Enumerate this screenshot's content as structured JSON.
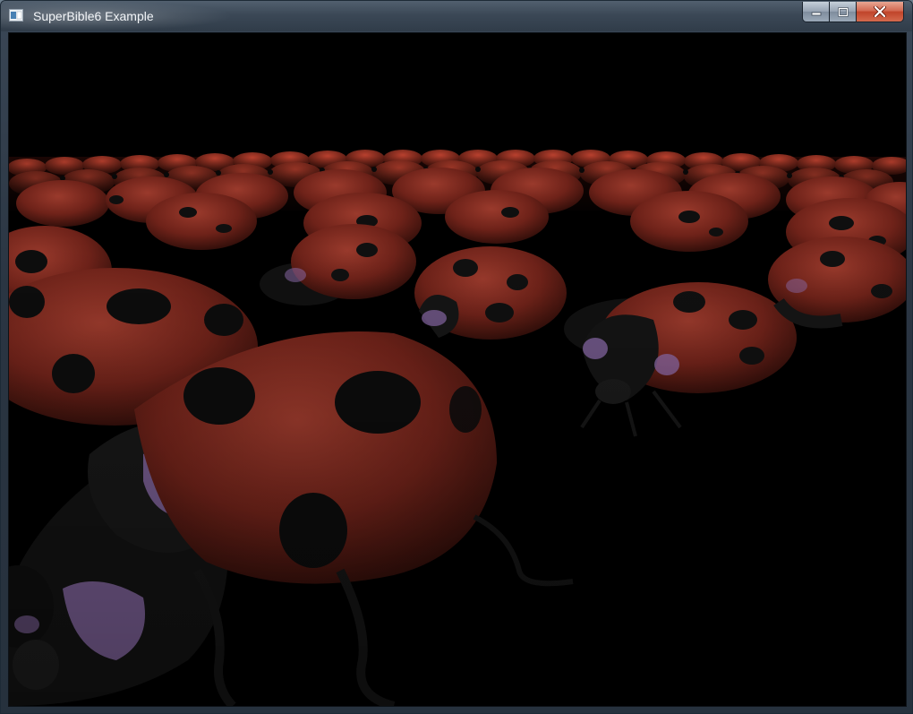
{
  "window": {
    "title": "SuperBible6 Example"
  },
  "controls": {
    "minimize_icon": "minimize-icon",
    "maximize_icon": "maximize-icon",
    "close_icon": "close-icon"
  },
  "colors": {
    "shell": "#7a2a22",
    "spot": "#111111",
    "body": "#141414",
    "marking": "#8a6aa8",
    "background": "#000000"
  }
}
